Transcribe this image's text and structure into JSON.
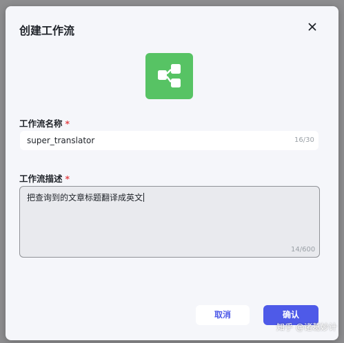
{
  "dialog": {
    "title": "创建工作流",
    "close_icon": "close-icon",
    "app_icon": "workflow-icon",
    "app_icon_color": "#57c364"
  },
  "name_field": {
    "label": "工作流名称",
    "required_mark": "*",
    "value": "super_translator",
    "counter": "16/30"
  },
  "desc_field": {
    "label": "工作流描述",
    "required_mark": "*",
    "value": "把查询到的文章标题翻译成英文",
    "counter": "14/600"
  },
  "buttons": {
    "cancel": "取消",
    "confirm": "确认",
    "confirm_color": "#4e5ae8"
  },
  "watermark": "知乎 @诸葛妙计"
}
